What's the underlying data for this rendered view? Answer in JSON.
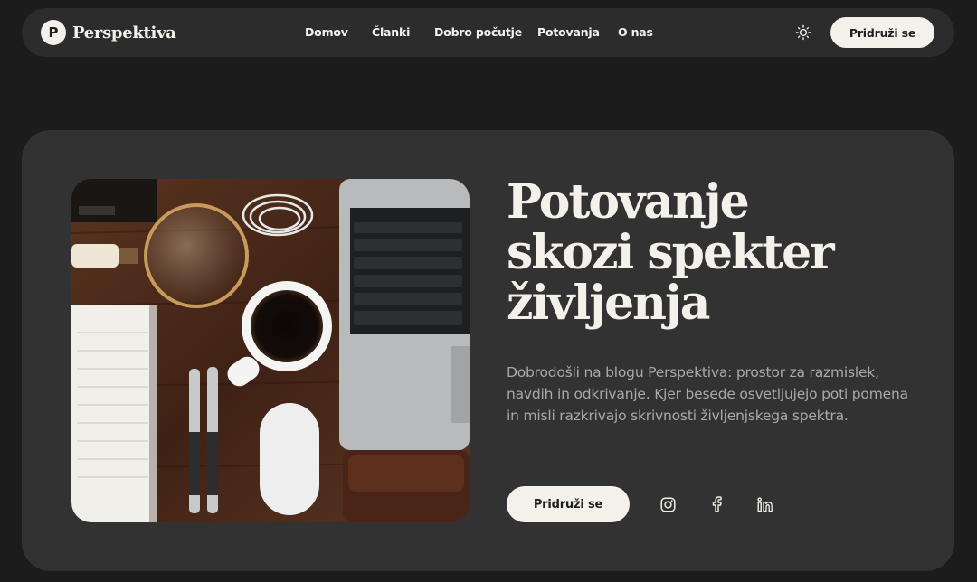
{
  "brand": {
    "logo_letter": "P",
    "name": "Perspektiva"
  },
  "nav": {
    "links": [
      {
        "label": "Domov"
      },
      {
        "label": "Članki"
      },
      {
        "label": "Dobro počutje"
      },
      {
        "label": "Potovanja"
      },
      {
        "label": "O nas"
      }
    ],
    "theme_icon": "sun-icon",
    "cta_label": "Pridruži se"
  },
  "hero": {
    "title_lines": [
      "Potovanje",
      "skozi spekter",
      "življenja"
    ],
    "description": "Dobrodošli na blogu Perspektiva: prostor za razmislek, navdih in odkrivanje. Kjer besede osvetljujejo poti pomena in misli razkrivajo skrivnosti življenjskega spektra.",
    "cta_label": "Pridruži se",
    "image_subject": "desk-flatlay-photo",
    "socials": [
      {
        "icon": "instagram-icon"
      },
      {
        "icon": "facebook-icon"
      },
      {
        "icon": "linkedin-icon"
      }
    ]
  },
  "colors": {
    "page_bg": "#1c1c1c",
    "surface": "#323232",
    "nav_bg": "#2c2c2c",
    "accent": "#f4f1ea",
    "muted_text": "#a9a9a9"
  }
}
